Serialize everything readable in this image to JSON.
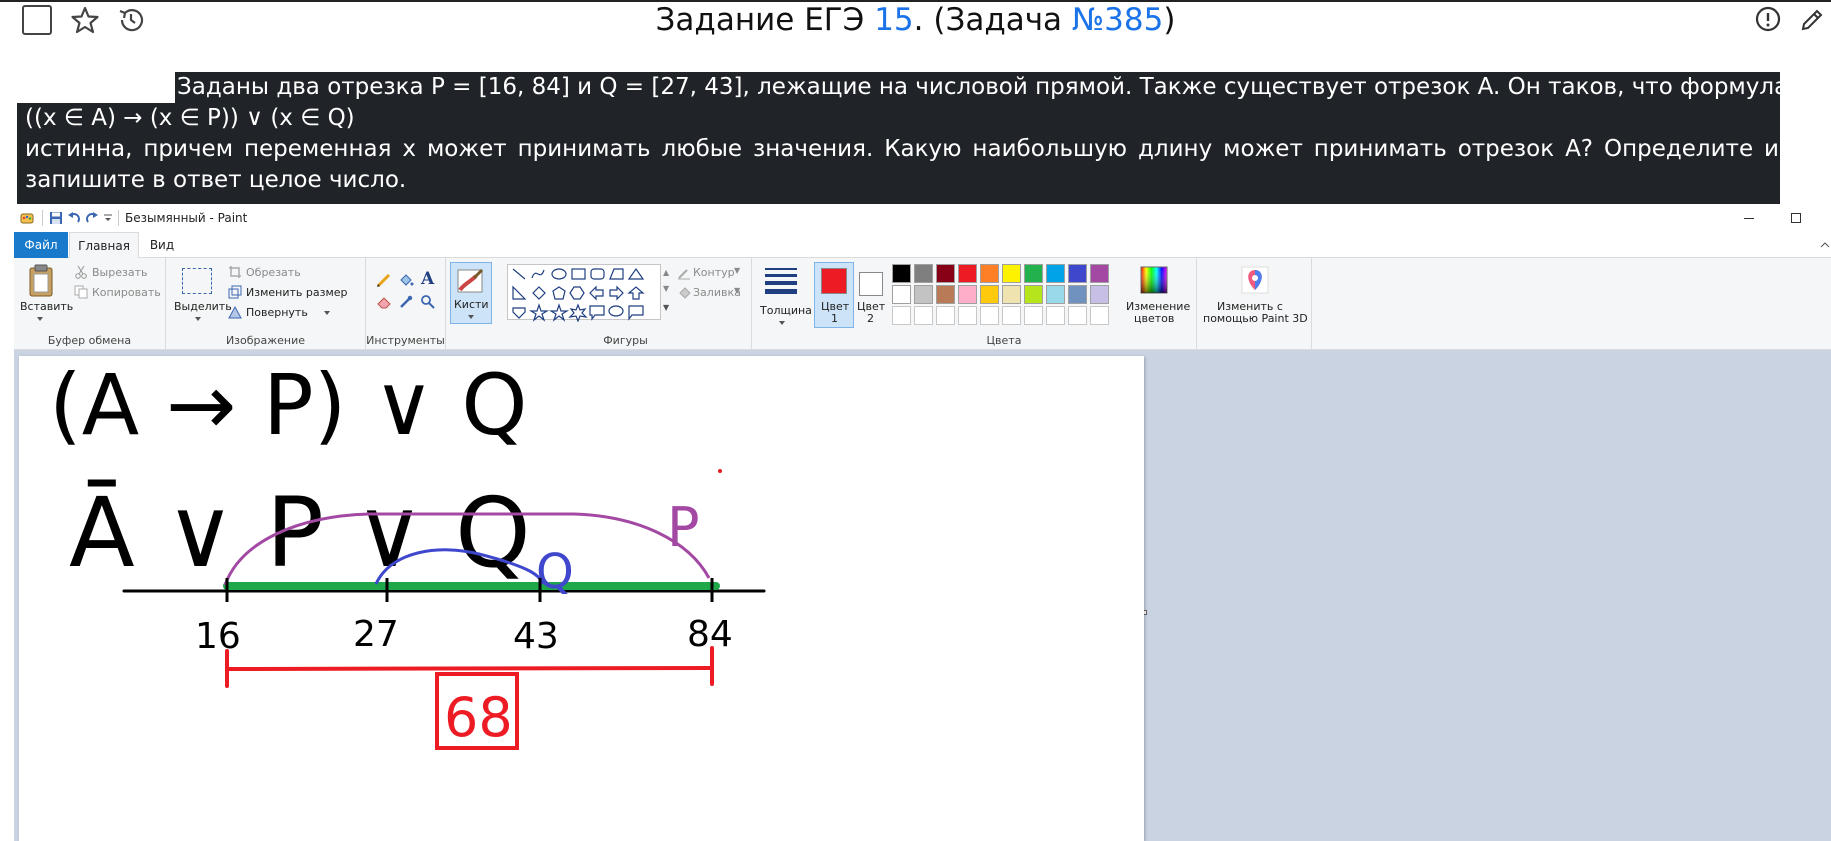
{
  "header": {
    "title_prefix": "Задание ЕГЭ ",
    "task_num": "15",
    "title_mid": ". (Задача ",
    "problem_num": "№385",
    "title_suffix": ")"
  },
  "question": {
    "line1": "Заданы два отрезка P = [16, 84] и Q = [27, 43], лежащие на числовой прямой. Также существует отрезок A. Он таков, что формула",
    "line2": "((x ∈ A) → (x ∈ P)) ∨ (x ∈ Q)",
    "line3": "истинна, причем переменная x может принимать любые значения. Какую наибольшую длину может принимать отрезок A? Определите и",
    "line4": "запишите в ответ целое число."
  },
  "paint": {
    "window_title": "Безымянный - Paint",
    "tabs": [
      "Файл",
      "Главная",
      "Вид"
    ],
    "clipboard": {
      "paste": "Вставить",
      "cut": "Вырезать",
      "copy": "Копировать",
      "label": "Буфер обмена"
    },
    "image": {
      "select": "Выделить",
      "crop": "Обрезать",
      "resize": "Изменить размер",
      "rotate": "Повернуть",
      "label": "Изображение"
    },
    "tools": {
      "label": "Инструменты"
    },
    "brushes": {
      "label": "Кисти"
    },
    "shapes": {
      "outline": "Контур",
      "fill": "Заливка",
      "label": "Фигуры"
    },
    "size": {
      "label": "Толщина"
    },
    "colors": {
      "color1": "Цвет 1",
      "color1_a": "Цвет",
      "color1_b": "1",
      "color2_a": "Цвет",
      "color2_b": "2",
      "edit": "Изменение",
      "edit_b": "цветов",
      "paint3d": "Изменить с",
      "paint3d_b": "помощью Paint 3D",
      "label": "Цвета",
      "color1_value": "#ed1c24",
      "color2_value": "#ffffff",
      "palette_row1": [
        "#000000",
        "#7f7f7f",
        "#880015",
        "#ed1c24",
        "#ff7f27",
        "#fff200",
        "#22b14c",
        "#00a2e8",
        "#3f48cc",
        "#a349a4"
      ],
      "palette_row2": [
        "#ffffff",
        "#c3c3c3",
        "#b97a57",
        "#ffaec9",
        "#ffc90e",
        "#efe4b0",
        "#b5e61d",
        "#99d9ea",
        "#7092be",
        "#c8bfe7"
      ]
    },
    "drawing": {
      "line1": "(A → P) ∨ Q",
      "line2": "Ā ∨ P ∨ Q",
      "label_p": "P",
      "label_q": "Q",
      "ticks": [
        "16",
        "27",
        "43",
        "84"
      ],
      "answer": "68"
    }
  }
}
